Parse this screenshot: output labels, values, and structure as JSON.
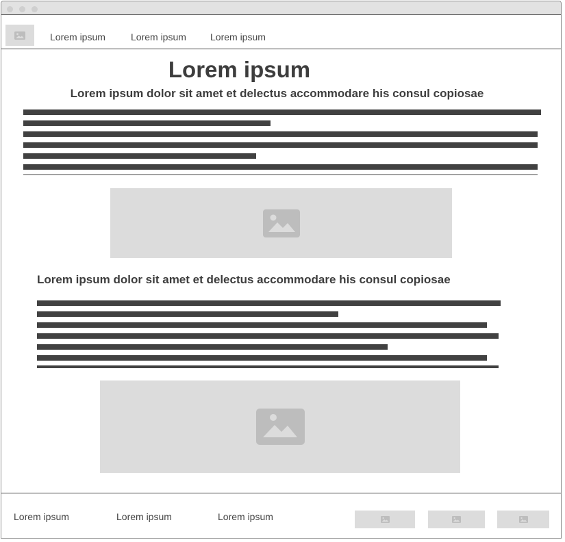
{
  "nav": {
    "logo_icon": "image-icon",
    "links": [
      "Lorem ipsum",
      "Lorem ipsum",
      "Lorem ipsum"
    ]
  },
  "main": {
    "title": "Lorem ipsum",
    "subtitle": "Lorem ipsum dolor sit amet et delectus accommodare his consul copiosae",
    "section_heading": "Lorem ipsum dolor sit amet et delectus accommodare his consul copiosae",
    "image_icon": "image-icon"
  },
  "footer": {
    "links": [
      "Lorem ipsum",
      "Lorem ipsum",
      "Lorem ipsum"
    ],
    "image_icon": "image-icon"
  },
  "colors": {
    "placeholder": "#dcdcdc",
    "icon": "#bdbdbd",
    "text_bar": "#414141",
    "titlebar": "#e2e2e2"
  }
}
